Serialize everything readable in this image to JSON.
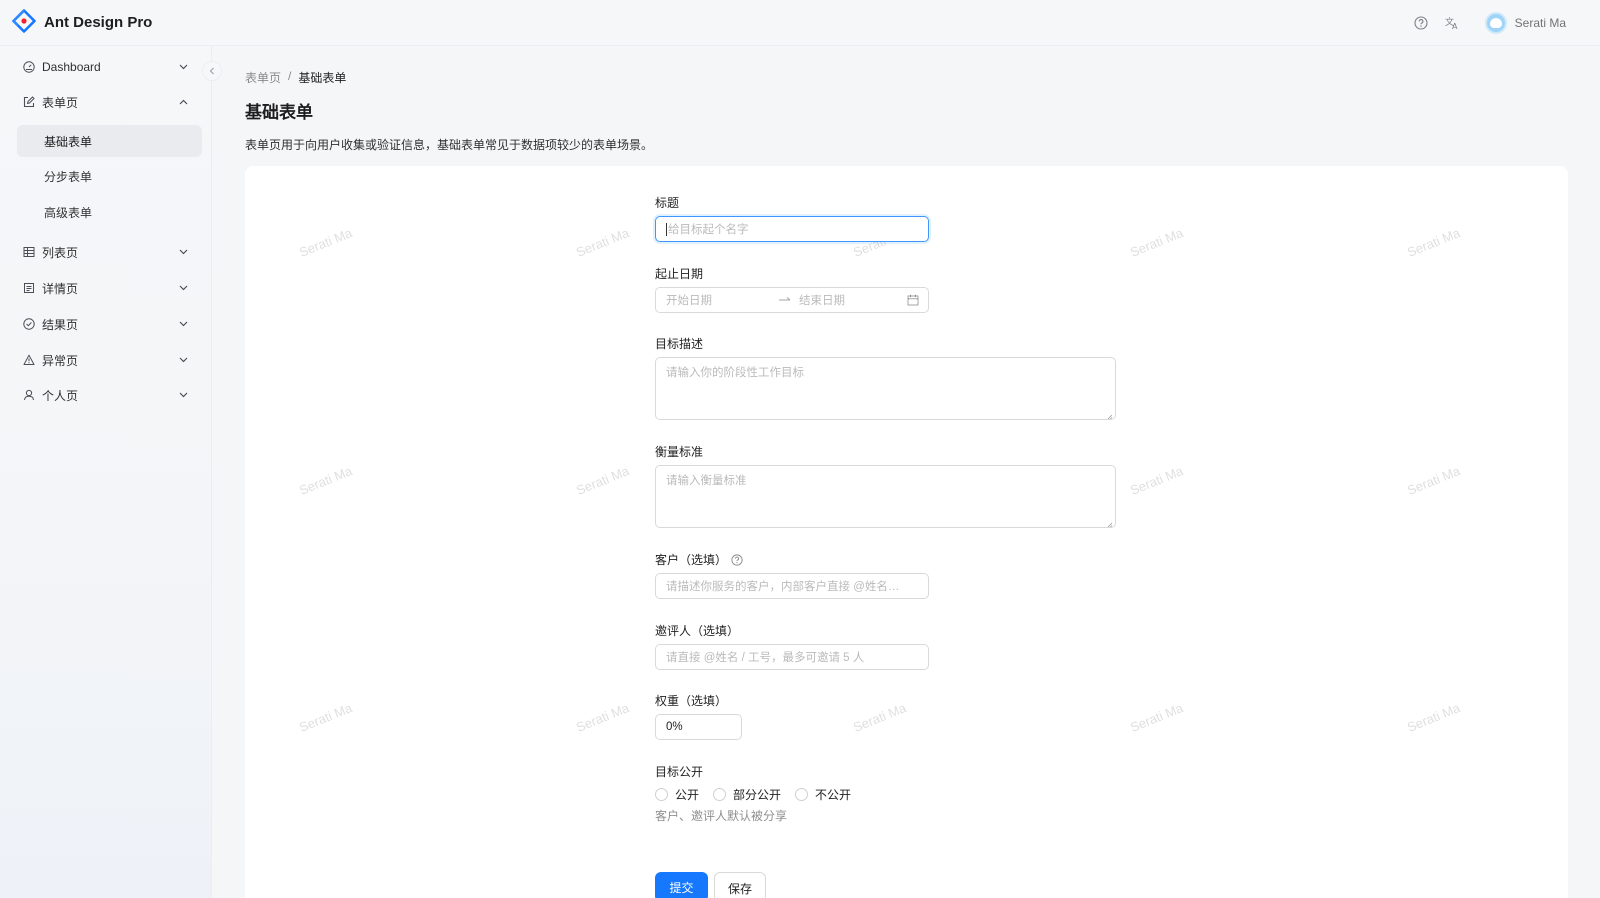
{
  "app": {
    "title": "Ant Design Pro"
  },
  "header": {
    "user_name": "Serati Ma"
  },
  "sidebar": {
    "items": [
      {
        "label": "Dashboard",
        "icon": "dashboard-icon"
      },
      {
        "label": "表单页",
        "icon": "form-icon",
        "expanded": true
      },
      {
        "label": "列表页",
        "icon": "table-icon"
      },
      {
        "label": "详情页",
        "icon": "profile-icon"
      },
      {
        "label": "结果页",
        "icon": "check-circle-icon"
      },
      {
        "label": "异常页",
        "icon": "warning-icon"
      },
      {
        "label": "个人页",
        "icon": "user-icon"
      }
    ],
    "subitems": [
      {
        "label": "基础表单",
        "active": true
      },
      {
        "label": "分步表单",
        "active": false
      },
      {
        "label": "高级表单",
        "active": false
      }
    ]
  },
  "breadcrumb": {
    "parent": "表单页",
    "separator": "/",
    "current": "基础表单"
  },
  "page": {
    "title": "基础表单",
    "description": "表单页用于向用户收集或验证信息，基础表单常见于数据项较少的表单场景。"
  },
  "watermark": "Serati Ma",
  "form": {
    "title_label": "标题",
    "title_placeholder": "给目标起个名字",
    "date_label": "起止日期",
    "date_start_placeholder": "开始日期",
    "date_end_placeholder": "结束日期",
    "goal_label": "目标描述",
    "goal_placeholder": "请输入你的阶段性工作目标",
    "standard_label": "衡量标准",
    "standard_placeholder": "请输入衡量标准",
    "client_label": "客户（选填）",
    "client_placeholder": "请描述你服务的客户，内部客户直接 @姓名…",
    "invites_label": "邀评人（选填）",
    "invites_placeholder": "请直接 @姓名 / 工号，最多可邀请 5 人",
    "weight_label": "权重（选填）",
    "weight_value": "0%",
    "public_label": "目标公开",
    "public_options": [
      "公开",
      "部分公开",
      "不公开"
    ],
    "public_help": "客户、邀评人默认被分享",
    "submit_label": "提交",
    "save_label": "保存"
  },
  "colors": {
    "primary": "#1677ff",
    "focus_border": "#4096ff"
  }
}
